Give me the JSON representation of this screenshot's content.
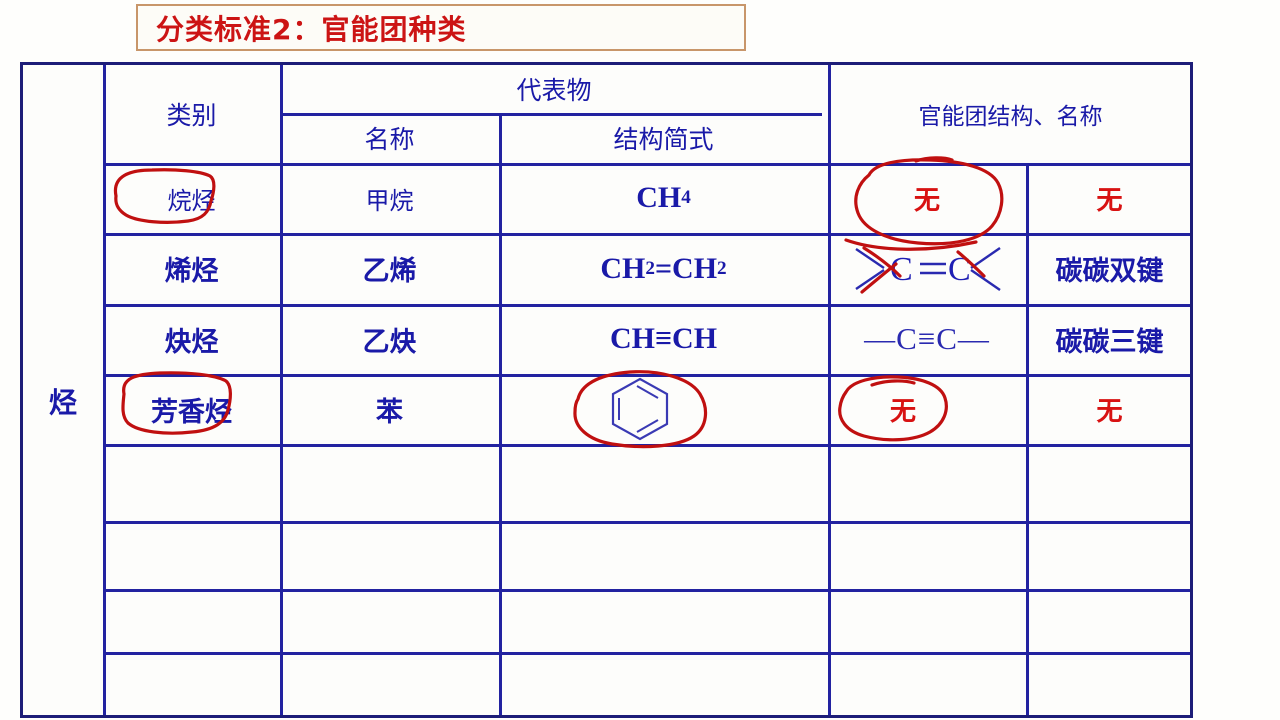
{
  "title": {
    "text": "分类标准2：官能团种类",
    "color": "#cc1414",
    "border_color": "#c8966a"
  },
  "table": {
    "border_color": "#2222a0",
    "text_color": "#1a1aa8",
    "annotation_color": "#c01010",
    "headers": {
      "corner": "",
      "category": "类别",
      "representative": "代表物",
      "rep_name": "名称",
      "rep_formula": "结构简式",
      "functional_group": "官能团结构、名称"
    },
    "group_label": "烃",
    "rows": [
      {
        "category": "烷烃",
        "category_circled": true,
        "name": "甲烷",
        "formula_html": "CH<sub>4</sub>",
        "fg_structure": "无",
        "fg_structure_kind": "text-red",
        "fg_structure_circled": true,
        "fg_name": "无",
        "fg_name_kind": "text-red"
      },
      {
        "category": "烯烃",
        "category_circled": false,
        "name": "乙烯",
        "formula_html": "CH<sub>2</sub>=CH<sub>2</sub>",
        "fg_structure": "C＝C",
        "fg_structure_kind": "double-bond-diagram",
        "fg_structure_circled": false,
        "fg_name": "碳碳双键",
        "fg_name_kind": "text-blue"
      },
      {
        "category": "炔烃",
        "category_circled": false,
        "name": "乙炔",
        "formula_html": "CH≡CH",
        "fg_structure": "—C≡C—",
        "fg_structure_kind": "triple-bond-text",
        "fg_structure_circled": false,
        "fg_name": "碳碳三键",
        "fg_name_kind": "text-blue"
      },
      {
        "category": "芳香烃",
        "category_circled": true,
        "name": "苯",
        "formula_html": "",
        "formula_kind": "benzene-ring",
        "formula_circled": true,
        "fg_structure": "无",
        "fg_structure_kind": "text-red",
        "fg_structure_circled": true,
        "fg_name": "无",
        "fg_name_kind": "text-red"
      },
      {
        "category": "",
        "name": "",
        "formula_html": "",
        "fg_structure": "",
        "fg_name": ""
      },
      {
        "category": "",
        "name": "",
        "formula_html": "",
        "fg_structure": "",
        "fg_name": ""
      },
      {
        "category": "",
        "name": "",
        "formula_html": "",
        "fg_structure": "",
        "fg_name": ""
      },
      {
        "category": "",
        "name": "",
        "formula_html": "",
        "fg_structure": "",
        "fg_name": ""
      }
    ]
  }
}
